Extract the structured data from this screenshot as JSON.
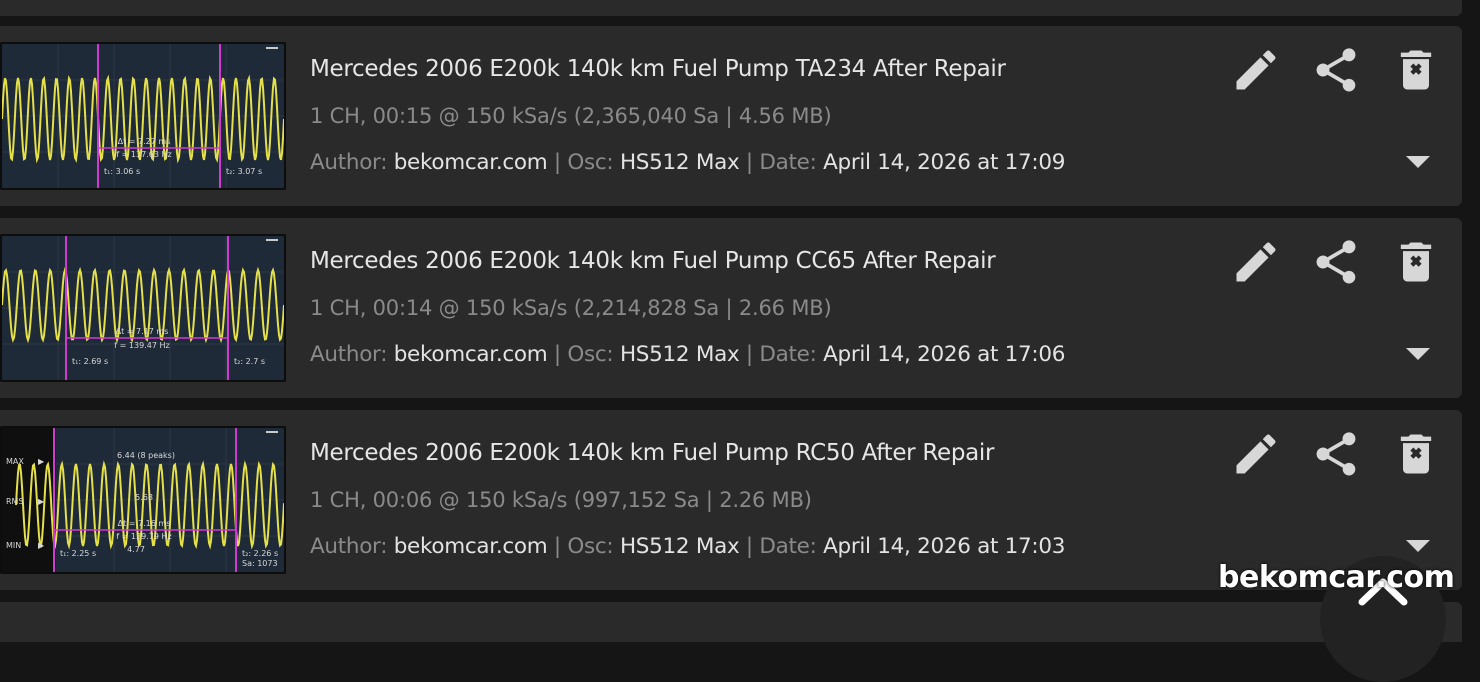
{
  "recordings": [
    {
      "title": "Mercedes 2006 E200k 140k km Fuel Pump TA234 After Repair",
      "meta": "1 CH, 00:15 @ 150 kSa/s (2,365,040 Sa | 4.56 MB)",
      "author_label": "Author:",
      "author": "bekomcar.com",
      "osc_label": "Osc:",
      "osc": "HS512 Max",
      "date_label": "Date:",
      "date": "April 14, 2026 at 17:09",
      "thumb": {
        "freq": "f = 137.63 Hz",
        "dt": "Δt = 7.27 ms",
        "t1": "t₁: 3.06 s",
        "t2": "t₂: 3.07 s"
      }
    },
    {
      "title": "Mercedes 2006 E200k 140k km Fuel Pump CC65 After Repair",
      "meta": "1 CH, 00:14 @ 150 kSa/s (2,214,828 Sa | 2.66 MB)",
      "author_label": "Author:",
      "author": "bekomcar.com",
      "osc_label": "Osc:",
      "osc": "HS512 Max",
      "date_label": "Date:",
      "date": "April 14, 2026 at 17:06",
      "thumb": {
        "freq": "f = 139.47 Hz",
        "dt": "Δt = 7.17 ms",
        "t1": "t₁: 2.69 s",
        "t2": "t₂: 2.7 s"
      }
    },
    {
      "title": "Mercedes 2006 E200k 140k km Fuel Pump RC50 After Repair",
      "meta": "1 CH, 00:06 @ 150 kSa/s (997,152 Sa | 2.26 MB)",
      "author_label": "Author:",
      "author": "bekomcar.com",
      "osc_label": "Osc:",
      "osc": "HS512 Max",
      "date_label": "Date:",
      "date": "April 14, 2026 at 17:03",
      "thumb": {
        "freq": "f = 139.79 Hz",
        "dt": "Δt = 7.16 ms",
        "t1": "t₁: 2.25 s",
        "t2": "t₂: 2.26 s",
        "sa": "Sa: 1073",
        "peaks": "6.44 (8 peaks)",
        "max_label": "MAX",
        "rms_label": "RMS",
        "min_label": "MIN",
        "mid_val": "5.68",
        "low_val": "4.77"
      }
    }
  ],
  "watermark": "bekomcar.com",
  "icons": {
    "edit": "pencil-icon",
    "share": "share-icon",
    "delete": "trash-icon",
    "expand": "chevron-down-icon",
    "scroll_top": "chevron-up-icon"
  },
  "colors": {
    "card": "#2a2a2a",
    "signal": "#e5e04a",
    "cursor": "#d03ad0"
  }
}
